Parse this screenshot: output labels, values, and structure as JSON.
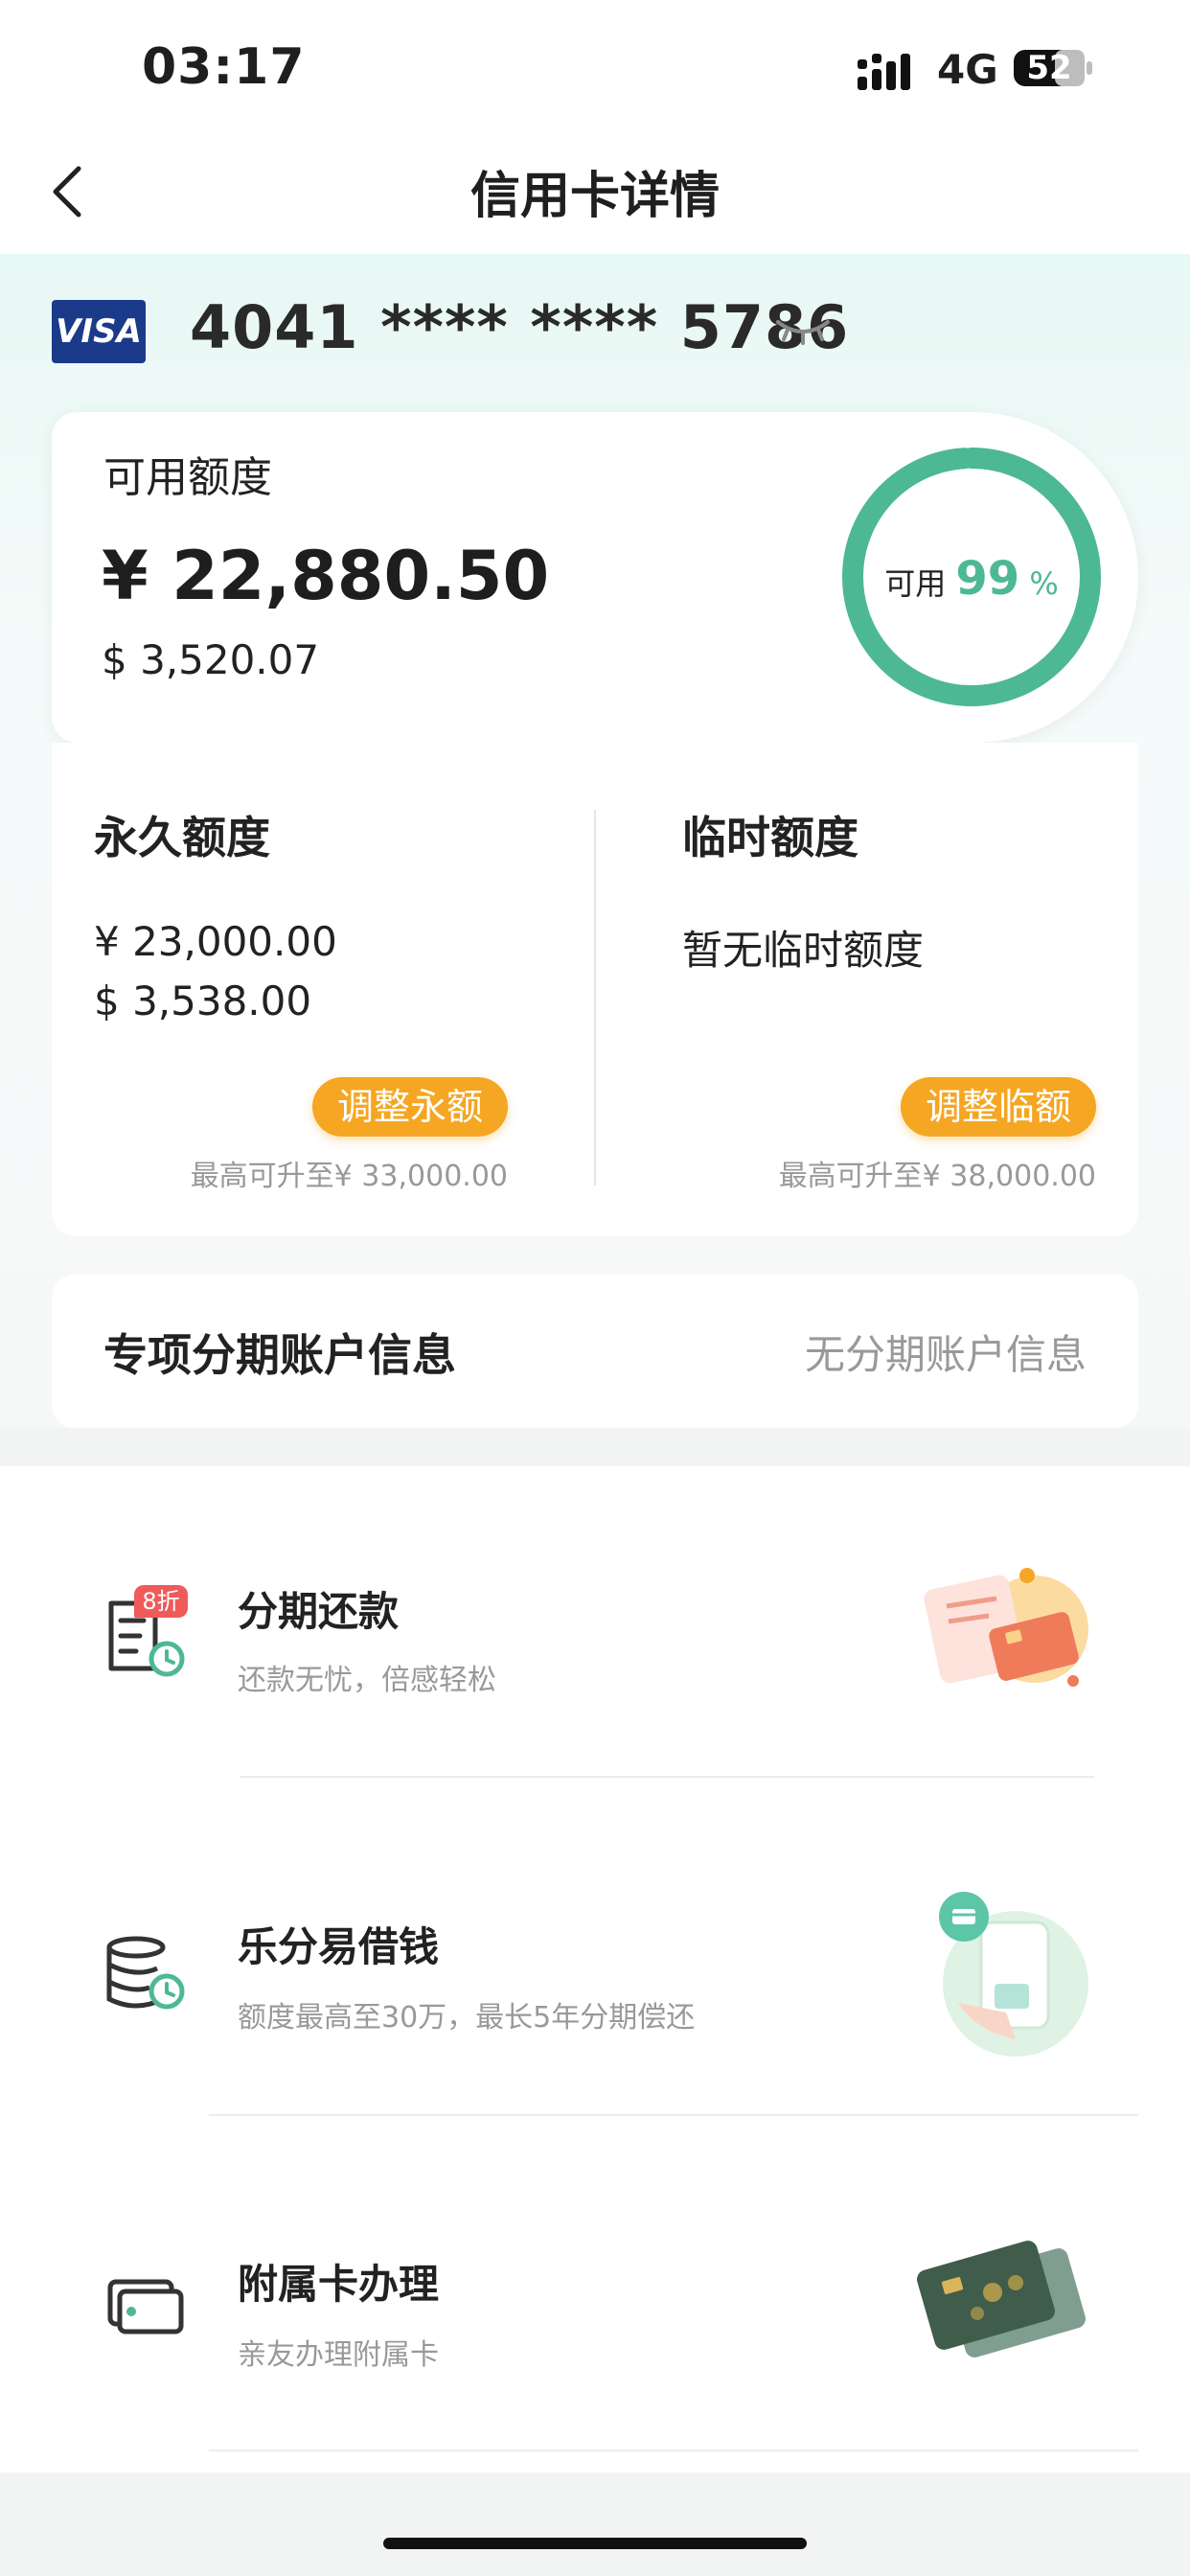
{
  "status_bar": {
    "time": "03:17",
    "network": "4G",
    "battery": "52"
  },
  "nav": {
    "title": "信用卡详情"
  },
  "card": {
    "brand": "VISA",
    "number": "4041 **** **** 5786"
  },
  "available": {
    "label": "可用额度",
    "amount_cny": "¥ 22,880.50",
    "amount_usd": "$ 3,520.07",
    "ring_label": "可用",
    "ring_percent": "99",
    "ring_percent_symbol": "%",
    "ring_fraction": 0.99
  },
  "permanent": {
    "label": "永久额度",
    "amount_cny": "¥ 23,000.00",
    "amount_usd": "$ 3,538.00",
    "button": "调整永额",
    "max_note": "最高可升至¥ 33,000.00"
  },
  "temporary": {
    "label": "临时额度",
    "none_text": "暂无临时额度",
    "button": "调整临额",
    "max_note": "最高可升至¥ 38,000.00"
  },
  "installment_account": {
    "label": "专项分期账户信息",
    "value": "无分期账户信息"
  },
  "services": [
    {
      "title": "分期还款",
      "subtitle": "还款无忧，倍感轻松",
      "badge": "8折"
    },
    {
      "title": "乐分易借钱",
      "subtitle": "额度最高至30万，最长5年分期偿还"
    },
    {
      "title": "附属卡办理",
      "subtitle": "亲友办理附属卡"
    }
  ],
  "colors": {
    "accent_green": "#4db894",
    "button_orange": "#f5a623",
    "visa_blue": "#1b3a8a",
    "badge_red": "#f05a5a"
  }
}
